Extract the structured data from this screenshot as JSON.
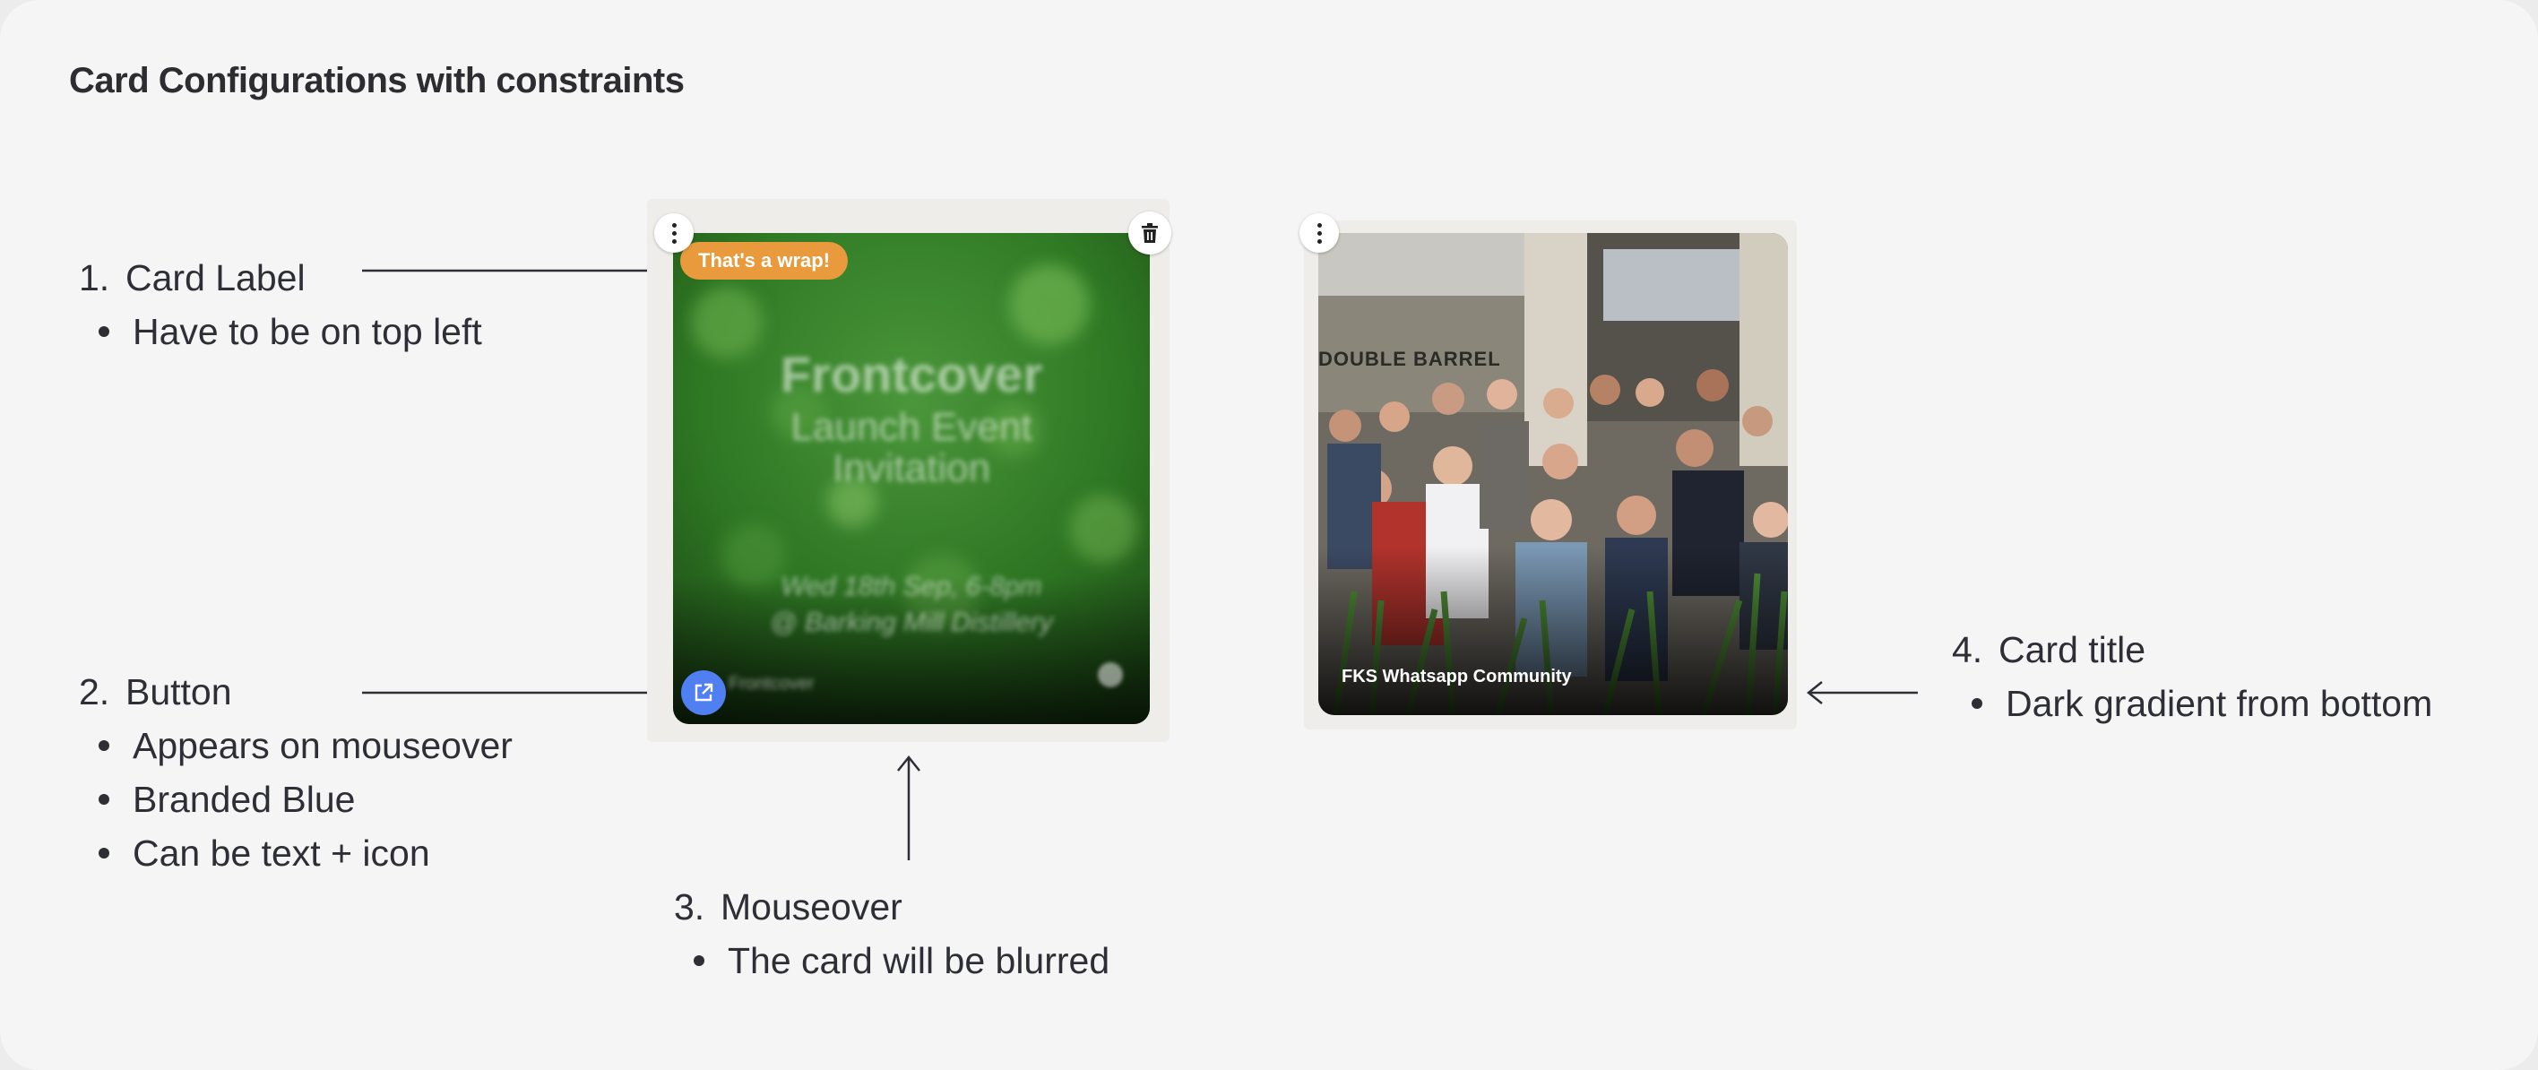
{
  "page": {
    "title": "Card Configurations with constraints"
  },
  "notes": [
    {
      "number": "1.",
      "heading": "Card Label",
      "bullets": [
        "Have to be on top left"
      ]
    },
    {
      "number": "2.",
      "heading": "Button",
      "bullets": [
        "Appears on mouseover",
        "Branded Blue",
        "Can be text + icon"
      ]
    },
    {
      "number": "3.",
      "heading": "Mouseover",
      "bullets": [
        "The card will be blurred"
      ]
    },
    {
      "number": "4.",
      "heading": "Card title",
      "bullets": [
        "Dark gradient from bottom"
      ]
    }
  ],
  "card_blurred": {
    "label": "That's a wrap!",
    "blurred_title": [
      "Frontcover",
      "Launch Event",
      "Invitation"
    ],
    "blurred_details": [
      "Wed 18th Sep, 6-8pm",
      "@ Barking Mill Distillery"
    ],
    "blurred_footer": "Frontcover",
    "menu_icon": "kebab-menu-icon",
    "delete_icon": "trash-icon",
    "button_icon": "external-link-icon",
    "button_color": "#4f7ff0",
    "label_color": "#e89a3c"
  },
  "card_photo": {
    "title": "FKS Whatsapp Community",
    "sign_text": "DOUBLE BARREL",
    "menu_icon": "kebab-menu-icon"
  }
}
